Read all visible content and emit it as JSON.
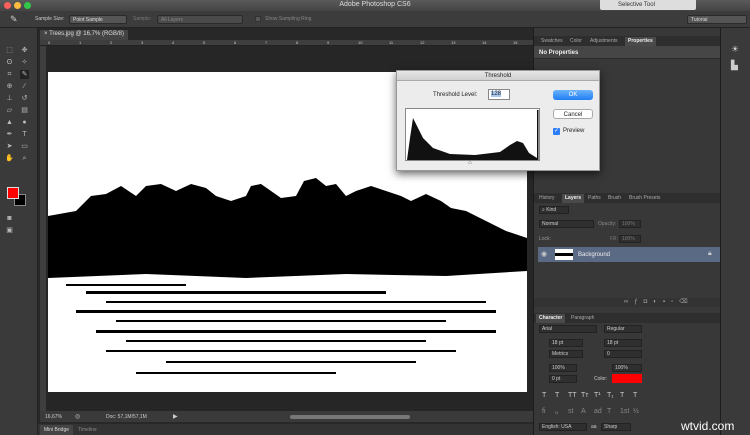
{
  "app": {
    "title": "Adobe Photoshop CS6",
    "floating_window": "Selective Tool",
    "workspace": "Tutorial"
  },
  "options": {
    "sample_size_label": "Sample Size:",
    "sample_size": "Point Sample",
    "sample_label": "Sample:",
    "sample": "All Layers",
    "show_ring": "Show Sampling Ring"
  },
  "document": {
    "tab": "Trees.jpg @ 16,7% (RGB/8)",
    "ruler": [
      "0",
      "1",
      "2",
      "3",
      "4",
      "5",
      "6",
      "7",
      "8",
      "9",
      "10",
      "11",
      "12",
      "13",
      "14",
      "15"
    ],
    "zoom": "16,67%",
    "doc_size": "Doc: 57,1M/57,1M"
  },
  "bottom_tabs": [
    "Mini Bridge",
    "Timeline"
  ],
  "colors": {
    "foreground": "#ff0000",
    "background": "#000000",
    "accent": "#3b82f6",
    "layer_selected": "#5a6a85"
  },
  "properties_panel": {
    "tabs": [
      "Swatches",
      "Color",
      "Adjustments",
      "Properties"
    ],
    "active": "Properties",
    "message": "No Properties"
  },
  "layers_panel": {
    "tabs": [
      "History",
      "Layers",
      "Paths",
      "Brush",
      "Brush Presets"
    ],
    "active": "Layers",
    "filter": "Kind",
    "blend_mode": "Normal",
    "opacity_label": "Opacity:",
    "opacity": "100%",
    "lock_label": "Lock:",
    "fill_label": "Fill:",
    "fill": "100%",
    "layers": [
      {
        "name": "Background"
      }
    ]
  },
  "character_panel": {
    "tabs": [
      "Character",
      "Paragraph"
    ],
    "active": "Character",
    "font": "Arial",
    "style": "Regular",
    "size": "18 pt",
    "leading": "18 pt",
    "kerning": "Metrics",
    "tracking": "0",
    "vscale": "100%",
    "hscale": "100%",
    "baseline": "0 pt",
    "color_label": "Color:",
    "type_buttons": [
      "T",
      "T",
      "TT",
      "Tт",
      "T¹",
      "T₁",
      "T",
      "T"
    ],
    "ot_buttons": [
      "ﬁ",
      "ℴ",
      "st",
      "A",
      "ad",
      "T",
      "1st",
      "½"
    ],
    "language": "English: USA",
    "aa_label": "aa",
    "antialias": "Sharp"
  },
  "threshold_dialog": {
    "title": "Threshold",
    "level_label": "Threshold Level:",
    "level": "128",
    "ok": "OK",
    "cancel": "Cancel",
    "preview": "Preview",
    "preview_checked": true
  },
  "watermark": "wtvid.com"
}
